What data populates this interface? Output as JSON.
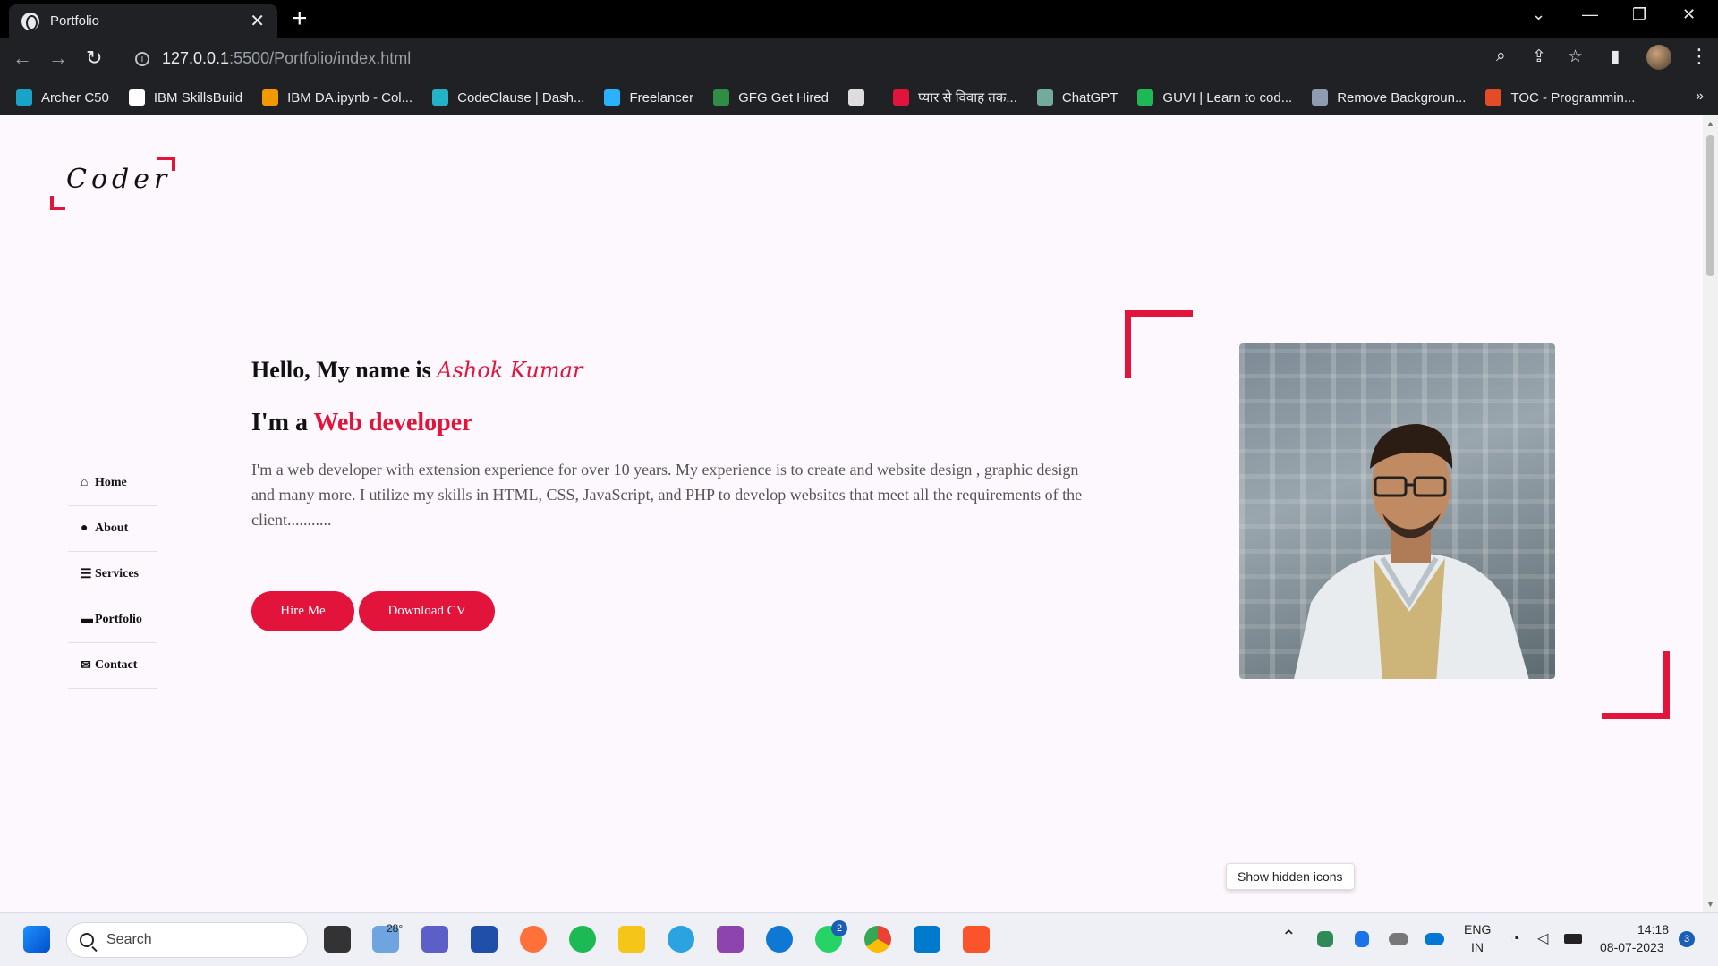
{
  "browser": {
    "tab_title": "Portfolio",
    "url_host": "127.0.0.1",
    "url_path": ":5500/Portfolio/index.html",
    "bookmarks": [
      {
        "label": "Archer C50",
        "color": "#1aa3c8"
      },
      {
        "label": "IBM SkillsBuild",
        "color": "#ffffff"
      },
      {
        "label": "IBM DA.ipynb - Col...",
        "color": "#f29900"
      },
      {
        "label": "CodeClause | Dash...",
        "color": "#22b3c7"
      },
      {
        "label": "Freelancer",
        "color": "#29b2fe"
      },
      {
        "label": "GFG Get Hired",
        "color": "#2f8d46"
      },
      {
        "label": "",
        "color": "#dddddd"
      },
      {
        "label": "प्यार से विवाह तक...",
        "color": "#e3143c"
      },
      {
        "label": "ChatGPT",
        "color": "#74aa9c"
      },
      {
        "label": "GUVI | Learn to cod...",
        "color": "#1db954"
      },
      {
        "label": "Remove Backgroun...",
        "color": "#8f9bb3"
      },
      {
        "label": "TOC - Programmin...",
        "color": "#e34c26"
      }
    ],
    "more": "»"
  },
  "sidebar": {
    "logo": "Coder",
    "nav": [
      {
        "icon": "⌂",
        "label": "Home"
      },
      {
        "icon": "●",
        "label": "About"
      },
      {
        "icon": "☰",
        "label": "Services"
      },
      {
        "icon": "▬",
        "label": "Portfolio"
      },
      {
        "icon": "✉",
        "label": "Contact"
      }
    ]
  },
  "hero": {
    "greeting": "Hello, My name is ",
    "name": "Ashok Kumar",
    "role_prefix": "I'm a ",
    "role": "Web developer",
    "description": "I'm a web developer with extension experience for over 10 years. My experience is to create and website design , graphic design and many more. I utilize my skills in HTML, CSS, JavaScript, and PHP to develop websites that meet all the requirements of the client...........",
    "hire_label": "Hire Me",
    "cv_label": "Download CV"
  },
  "accent_color": "#e3143c",
  "tooltip": "Show hidden icons",
  "taskbar": {
    "search_placeholder": "Search",
    "weather": "28°",
    "whatsapp_badge": "2",
    "language": "ENG",
    "region": "IN",
    "time": "14:18",
    "date": "08-07-2023",
    "notification_count": "3"
  }
}
